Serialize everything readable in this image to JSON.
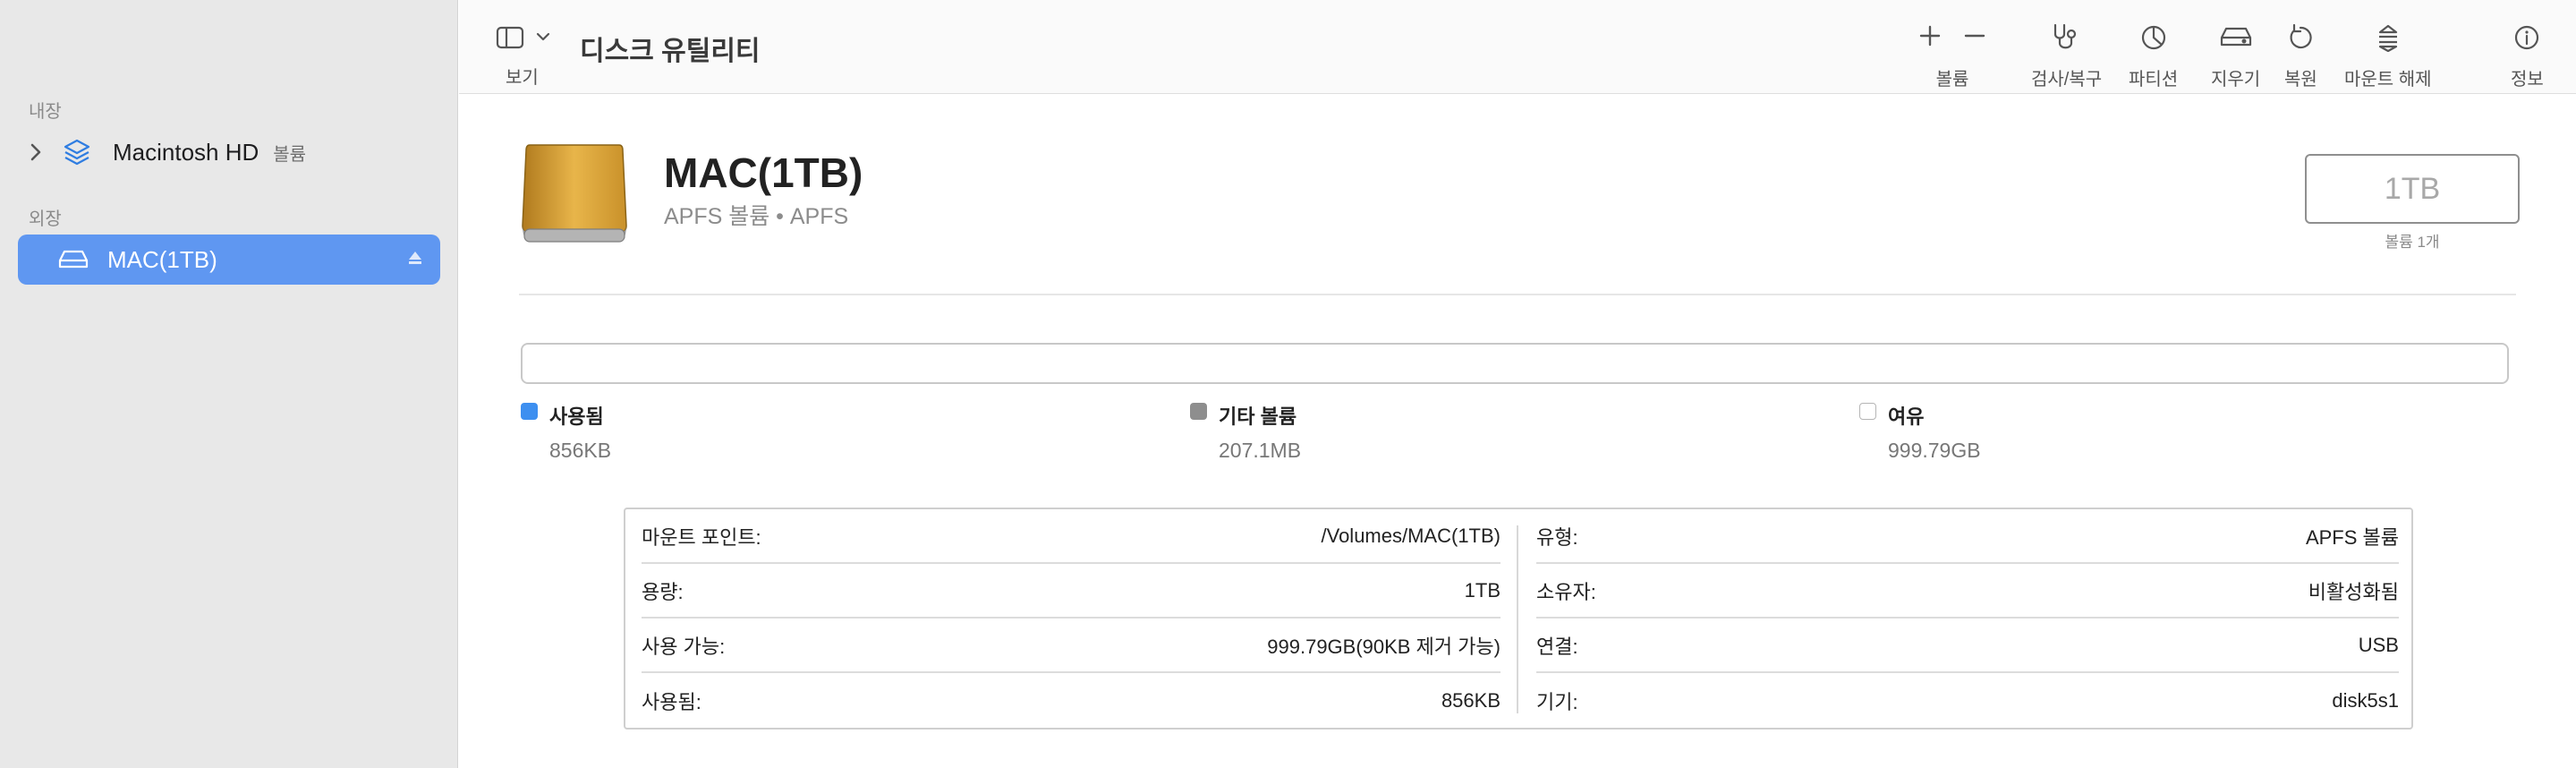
{
  "sidebar": {
    "internal_label": "내장",
    "external_label": "외장",
    "items": [
      {
        "name": "Macintosh HD",
        "sub": "볼륨"
      },
      {
        "name": "MAC(1TB)"
      }
    ]
  },
  "toolbar": {
    "view_label": "보기",
    "title": "디스크 유틸리티",
    "buttons": {
      "volume": "볼륨",
      "firstaid": "검사/복구",
      "partition": "파티션",
      "erase": "지우기",
      "restore": "복원",
      "unmount": "마운트 해제",
      "info": "정보"
    }
  },
  "volume": {
    "name": "MAC(1TB)",
    "subtitle": "APFS 볼륨 • APFS",
    "size": "1TB",
    "size_caption": "볼륨 1개"
  },
  "legend": [
    {
      "name": "사용됨",
      "value": "856KB",
      "color": "#3d8ff0"
    },
    {
      "name": "기타 볼륨",
      "value": "207.1MB",
      "color": "#8e8e8e"
    },
    {
      "name": "여유",
      "value": "999.79GB",
      "color": "#ffffff"
    }
  ],
  "info": {
    "left": [
      {
        "label": "마운트 포인트:",
        "value": "/Volumes/MAC(1TB)"
      },
      {
        "label": "용량:",
        "value": "1TB"
      },
      {
        "label": "사용 가능:",
        "value": "999.79GB(90KB 제거 가능)"
      },
      {
        "label": "사용됨:",
        "value": "856KB"
      }
    ],
    "right": [
      {
        "label": "유형:",
        "value": "APFS 볼륨"
      },
      {
        "label": "소유자:",
        "value": "비활성화됨"
      },
      {
        "label": "연결:",
        "value": "USB"
      },
      {
        "label": "기기:",
        "value": "disk5s1"
      }
    ]
  },
  "colors": {
    "sidebar_selected": "#5f97f1",
    "used": "#3d8ff0",
    "other": "#8e8e8e",
    "drive": "#d9a536"
  }
}
